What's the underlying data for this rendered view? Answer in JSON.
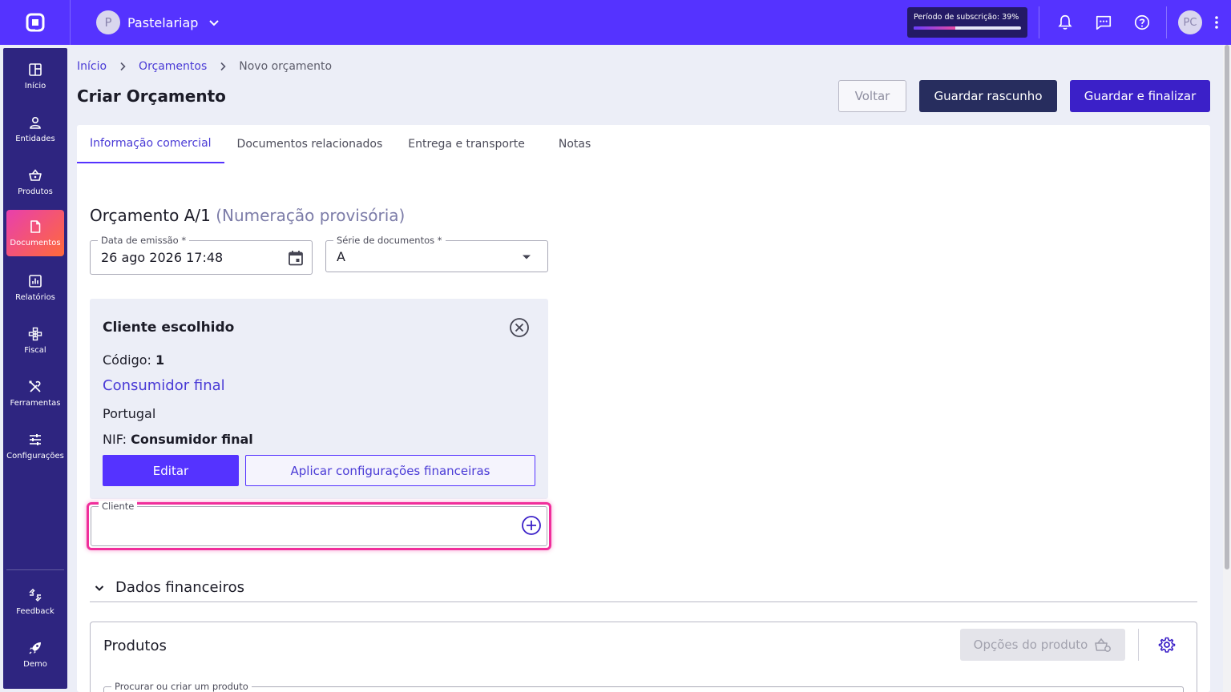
{
  "topbar": {
    "company_initial": "P",
    "company_name": "Pastelariap",
    "subscription_label": "Período de subscrição: 39%",
    "subscription_progress": 0.39,
    "user_initials": "PC",
    "accent": "#5533ff"
  },
  "sidebar": {
    "items": [
      {
        "label": "Início",
        "icon": "home-grid-icon"
      },
      {
        "label": "Entidades",
        "icon": "person-icon"
      },
      {
        "label": "Produtos",
        "icon": "basket-icon"
      },
      {
        "label": "Documentos",
        "icon": "document-icon"
      },
      {
        "label": "Relatórios",
        "icon": "chart-icon"
      },
      {
        "label": "Fiscal",
        "icon": "hierarchy-icon"
      },
      {
        "label": "Ferramentas",
        "icon": "tools-icon"
      },
      {
        "label": "Configurações",
        "icon": "sliders-icon"
      }
    ],
    "bottom": [
      {
        "label": "Feedback",
        "icon": "feedback-icon"
      },
      {
        "label": "Demo",
        "icon": "rocket-icon"
      }
    ],
    "active_index": 3
  },
  "breadcrumb": {
    "home": "Início",
    "section": "Orçamentos",
    "current": "Novo orçamento"
  },
  "header": {
    "title": "Criar Orçamento",
    "back_label": "Voltar",
    "draft_label": "Guardar rascunho",
    "finalize_label": "Guardar e finalizar"
  },
  "tabs": [
    {
      "label": "Informação comercial",
      "active": true
    },
    {
      "label": "Documentos relacionados",
      "active": false
    },
    {
      "label": "Entrega e transporte",
      "active": false
    },
    {
      "label": "Notas",
      "active": false
    }
  ],
  "document": {
    "heading": "Orçamento A/1",
    "provisional": "(Numeração provisória)",
    "issue_date_label": "Data de emissão *",
    "issue_date_value": "26 ago 2026 17:48",
    "series_label": "Série de documentos *",
    "series_value": "A"
  },
  "client": {
    "title": "Cliente escolhido",
    "code_label": "Código:",
    "code_value": "1",
    "name": "Consumidor final",
    "country": "Portugal",
    "nif_label": "NIF:",
    "nif_value": "Consumidor final",
    "edit_label": "Editar",
    "apply_label": "Aplicar configurações financeiras",
    "field_label": "Cliente"
  },
  "financial": {
    "label": "Dados financeiros"
  },
  "products": {
    "title": "Produtos",
    "options_label": "Opções do produto",
    "search_label": "Procurar ou criar um produto"
  }
}
